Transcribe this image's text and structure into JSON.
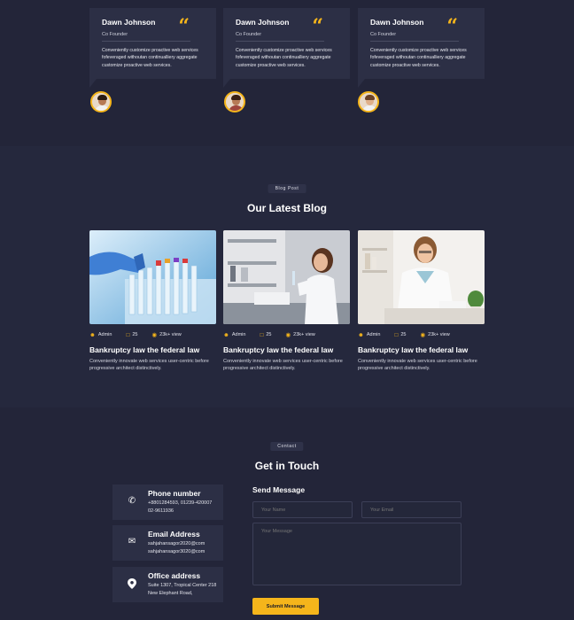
{
  "testimonials": [
    {
      "name": "Dawn Johnson",
      "role": "Co Founder",
      "text": "Conveniently customize proactive web services fofeveraged withoutan continualliery aggregate customize proactive web services."
    },
    {
      "name": "Dawn Johnson",
      "role": "Co Founder",
      "text": "Conveniently customize proactive web services fofeveraged withoutan continualliery aggregate customize proactive web services."
    },
    {
      "name": "Dawn Johnson",
      "role": "Co Founder",
      "text": "Conveniently customize proactive web services fofeveraged withoutan continualliery aggregate customize proactive web services."
    }
  ],
  "blog": {
    "tag": "Blog Post",
    "title": "Our Latest Blog",
    "posts": [
      {
        "author": "Admin",
        "comments": "25",
        "views": "23k+ view",
        "title": "Bankruptcy law the federal law",
        "excerpt": "Conveniently innovate web services user-centric before progressive architect distinctively."
      },
      {
        "author": "Admin",
        "comments": "25",
        "views": "23k+ view",
        "title": "Bankruptcy law the federal law",
        "excerpt": "Conveniently innovate web services user-centric before progressive architect distinctively."
      },
      {
        "author": "Admin",
        "comments": "25",
        "views": "23k+ view",
        "title": "Bankruptcy law the federal law",
        "excerpt": "Conveniently innovate web services user-centric before progressive architect distinctively."
      }
    ]
  },
  "contact": {
    "tag": "Contact",
    "title": "Get in Touch",
    "phone": {
      "title": "Phone number",
      "line1": "+8801284593, 01239-420007",
      "line2": "02-9611936"
    },
    "email": {
      "title": "Email Address",
      "line1": "sahjahansagor2020@com",
      "line2": "sahjahansagor3020@com"
    },
    "office": {
      "title": "Office address",
      "line1": "Suite 1307, Tropical Center 218",
      "line2": "New Elephant Road,"
    },
    "form": {
      "heading": "Send Message",
      "name_placeholder": "Your Name",
      "email_placeholder": "Your Email",
      "message_placeholder": "Your Message",
      "submit_label": "Submit Message"
    }
  },
  "colors": {
    "accent": "#f5b51b",
    "background": "#232539",
    "card": "#2c2f45"
  }
}
